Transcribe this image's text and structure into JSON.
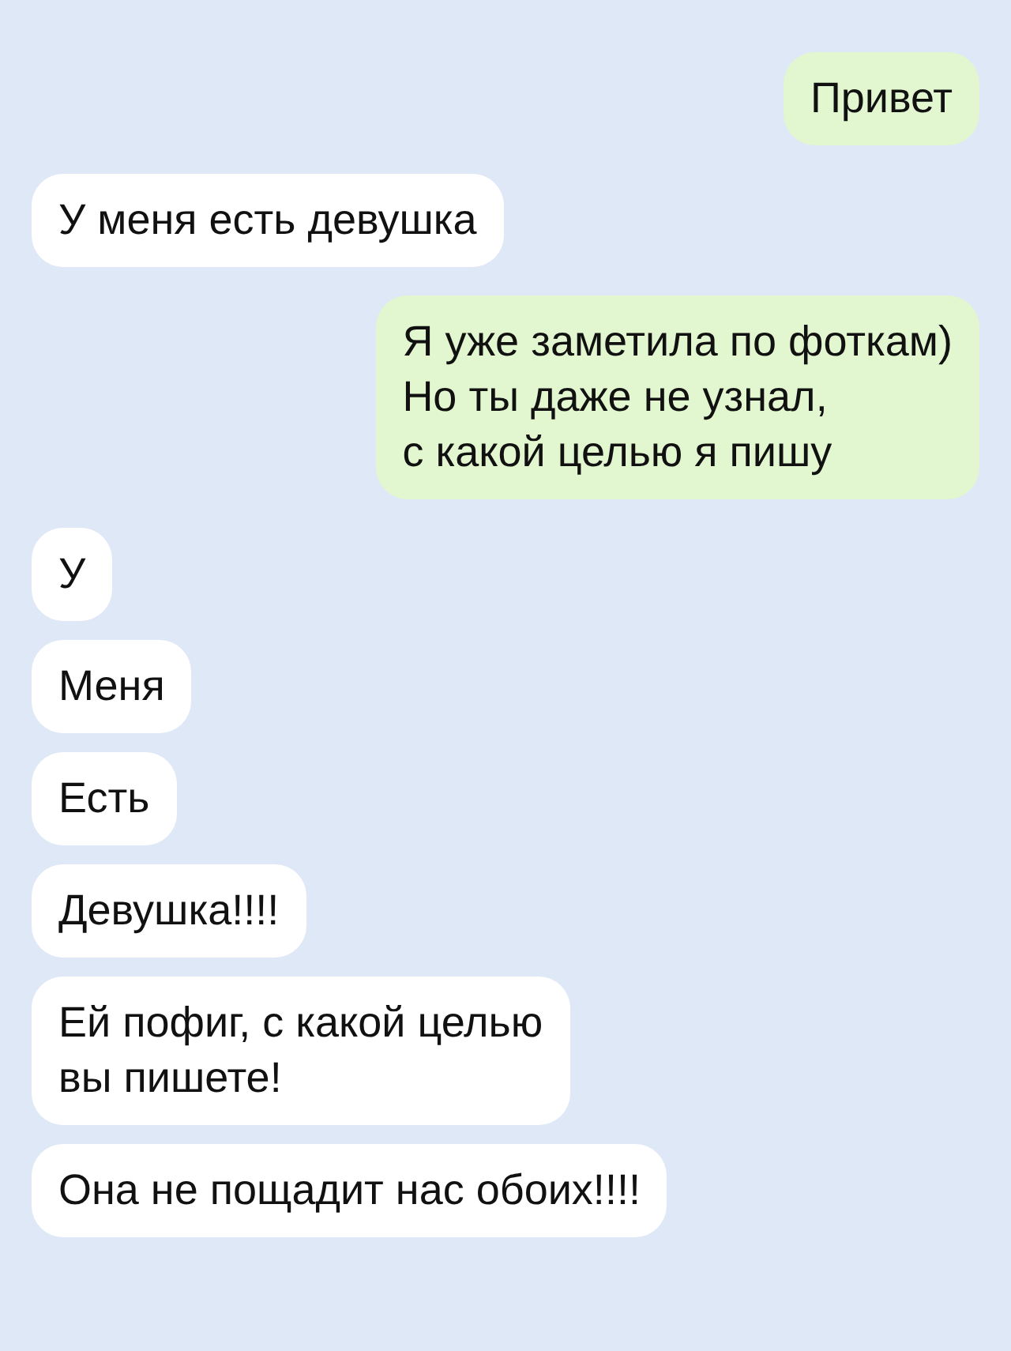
{
  "messages": [
    {
      "kind": "outgoing",
      "text": "Привет"
    },
    {
      "kind": "incoming",
      "text": "У меня есть девушка"
    },
    {
      "kind": "outgoing",
      "text": "Я уже заметила по фоткам)\nНо ты даже не узнал,\nс какой целью я пишу"
    },
    {
      "kind": "incoming",
      "text": "У"
    },
    {
      "kind": "incoming",
      "text": "Меня"
    },
    {
      "kind": "incoming",
      "text": "Есть"
    },
    {
      "kind": "incoming",
      "text": "Девушка!!!!"
    },
    {
      "kind": "incoming",
      "text": "Ей пофиг, с какой целью\nвы пишете!"
    },
    {
      "kind": "incoming",
      "text": "Она не пощадит нас обоих!!!!"
    }
  ]
}
